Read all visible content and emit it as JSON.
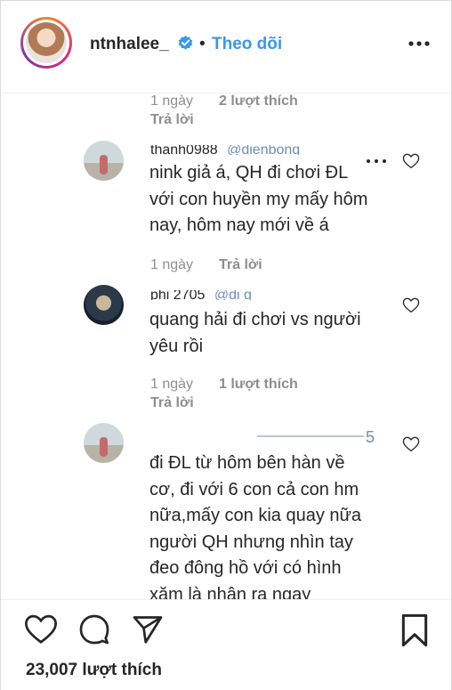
{
  "header": {
    "username": "ntnhalee_",
    "separator": "•",
    "follow_label": "Theo dõi"
  },
  "comments": [
    {
      "time": "1 ngày",
      "likes": "2 lượt thích",
      "reply": "Trả lời"
    },
    {
      "name_fragment": "thanh0988",
      "handle_fragment": "@dienbong",
      "text": "nink giả á, QH đi chơi ĐL với con huyền my mấy hôm nay, hôm nay mới về á",
      "time": "1 ngày",
      "reply": "Trả lời"
    },
    {
      "name_fragment": "phi      2705",
      "handle_fragment": "@di        g",
      "text": "quang hải đi chơi vs người yêu rồi",
      "time": "1 ngày",
      "likes": "1 lượt thích",
      "reply": "Trả lời"
    },
    {
      "handle_fragment": "5",
      "text": "đi ĐL từ hôm bên hàn về cơ, đi với 6 con cả con hm nữa,mấy con kia quay nữa người QH nhưng nhìn tay đeo đông hồ với có hình xăm là nhận ra ngay"
    }
  ],
  "footer": {
    "likes_count": "23,007 lượt thích"
  },
  "colors": {
    "link_blue": "#3897f0",
    "muted": "#8e8e8e",
    "text": "#262626"
  }
}
